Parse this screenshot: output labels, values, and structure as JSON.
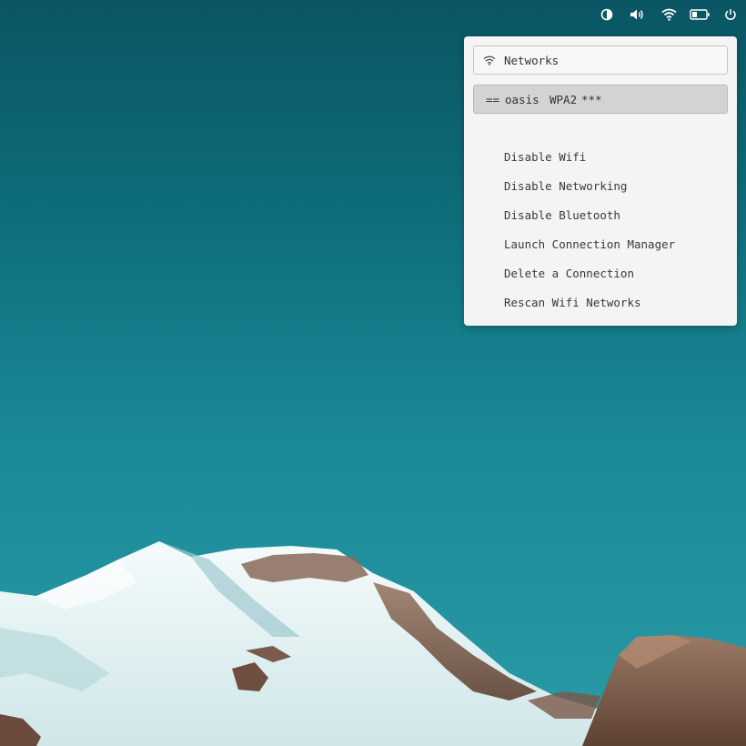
{
  "tray": {
    "icons": [
      "contrast-icon",
      "volume-icon",
      "wifi-icon",
      "battery-icon",
      "power-icon"
    ]
  },
  "menu": {
    "search_label": "Networks",
    "network": {
      "marker": "==",
      "ssid": "oasis",
      "security": "WPA2",
      "signal": "***"
    },
    "items": [
      "Disable Wifi",
      "Disable Networking",
      "Disable Bluetooth",
      "Launch Connection Manager",
      "Delete a Connection",
      "Rescan Wifi Networks"
    ]
  },
  "colors": {
    "sky_top": "#0a5563",
    "sky_bottom": "#2a9aa6",
    "menu_bg": "#f4f4f4",
    "selected_row": "#d3d3d3"
  }
}
